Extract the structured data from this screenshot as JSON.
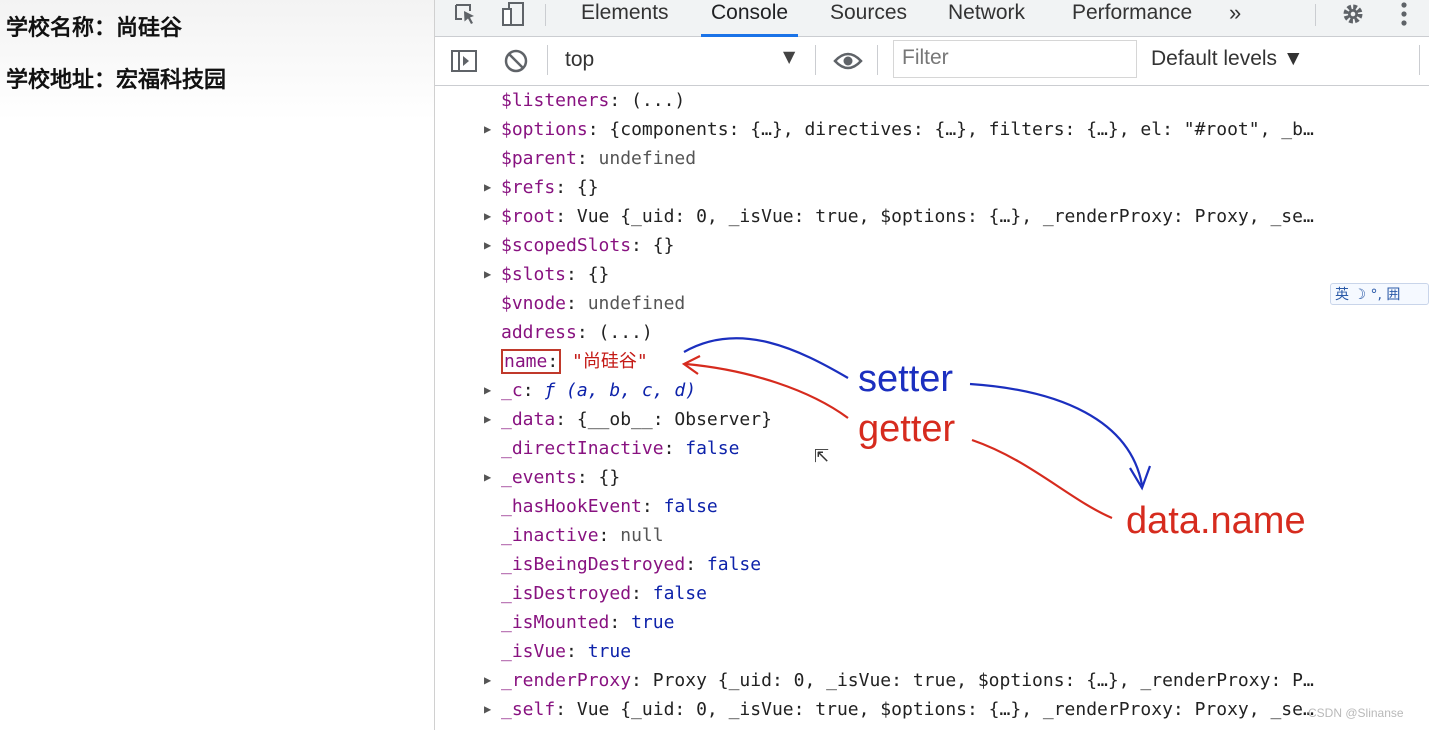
{
  "page": {
    "school_name_line": "学校名称：尚硅谷",
    "school_address_line": "学校地址：宏福科技园"
  },
  "devtools": {
    "tabs": [
      {
        "label": "Elements",
        "active": false
      },
      {
        "label": "Console",
        "active": true
      },
      {
        "label": "Sources",
        "active": false
      },
      {
        "label": "Network",
        "active": false
      },
      {
        "label": "Performance",
        "active": false
      }
    ],
    "more_tabs": "»",
    "toolbar": {
      "context": "top",
      "filter_placeholder": "Filter",
      "levels": "Default levels ▼"
    },
    "accent_color": "#1a73e8"
  },
  "console_rows": [
    {
      "expandable": false,
      "key": "$listeners",
      "value": "(...)",
      "vclass": "p"
    },
    {
      "expandable": true,
      "key": "$options",
      "value": "{components: {…}, directives: {…}, filters: {…}, el: \"#root\", _b…",
      "vclass": "p"
    },
    {
      "expandable": false,
      "key": "$parent",
      "value": "undefined",
      "vclass": "u"
    },
    {
      "expandable": true,
      "key": "$refs",
      "value": "{}",
      "vclass": "p"
    },
    {
      "expandable": true,
      "key": "$root",
      "value": "Vue {_uid: 0, _isVue: true, $options: {…}, _renderProxy: Proxy, _se…",
      "vclass": "p"
    },
    {
      "expandable": true,
      "key": "$scopedSlots",
      "value": "{}",
      "vclass": "p"
    },
    {
      "expandable": true,
      "key": "$slots",
      "value": "{}",
      "vclass": "p"
    },
    {
      "expandable": false,
      "key": "$vnode",
      "value": "undefined",
      "vclass": "u"
    },
    {
      "expandable": false,
      "key": "address",
      "value": "(...)",
      "vclass": "p"
    },
    {
      "expandable": false,
      "key": "name",
      "value": "\"尚硅谷\"",
      "vclass": "s",
      "highlight": true
    },
    {
      "expandable": true,
      "key": "_c",
      "value": "ƒ (a, b, c, d)",
      "vclass": "it"
    },
    {
      "expandable": true,
      "key": "_data",
      "value": "{__ob__: Observer}",
      "vclass": "p"
    },
    {
      "expandable": false,
      "key": "_directInactive",
      "value": "false",
      "vclass": "kw"
    },
    {
      "expandable": true,
      "key": "_events",
      "value": "{}",
      "vclass": "p"
    },
    {
      "expandable": false,
      "key": "_hasHookEvent",
      "value": "false",
      "vclass": "kw"
    },
    {
      "expandable": false,
      "key": "_inactive",
      "value": "null",
      "vclass": "u"
    },
    {
      "expandable": false,
      "key": "_isBeingDestroyed",
      "value": "false",
      "vclass": "kw"
    },
    {
      "expandable": false,
      "key": "_isDestroyed",
      "value": "false",
      "vclass": "kw"
    },
    {
      "expandable": false,
      "key": "_isMounted",
      "value": "true",
      "vclass": "kw"
    },
    {
      "expandable": false,
      "key": "_isVue",
      "value": "true",
      "vclass": "kw"
    },
    {
      "expandable": true,
      "key": "_renderProxy",
      "value": "Proxy {_uid: 0, _isVue: true, $options: {…}, _renderProxy: P…",
      "vclass": "p"
    },
    {
      "expandable": true,
      "key": "_self",
      "value": "Vue {_uid: 0, _isVue: true, $options: {…}, _renderProxy: Proxy, _se…",
      "vclass": "p"
    }
  ],
  "annotations": {
    "setter": {
      "text": "setter",
      "color": "#1b2fbf"
    },
    "getter": {
      "text": "getter",
      "color": "#d62b1e"
    },
    "data_name": {
      "text": "data.name",
      "color": "#d62b1e"
    }
  },
  "ime_text": "英 ☽ °, 囲",
  "watermark": "CSDN @Slinanse"
}
